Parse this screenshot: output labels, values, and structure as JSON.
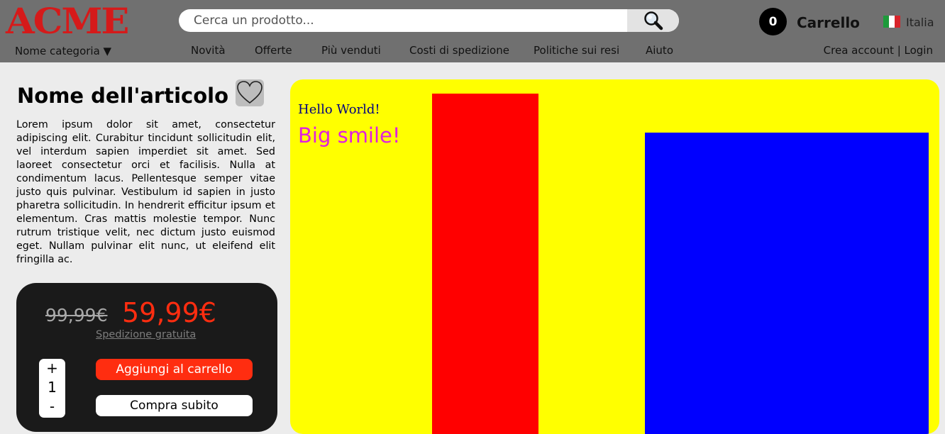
{
  "header": {
    "logo": "ACME",
    "category": "Nome categoria ▼",
    "search_placeholder": "Cerca un prodotto...",
    "cart_count": "0",
    "cart_label": "Carrello",
    "country": "Italia",
    "nav": [
      "Novità",
      "Offerte",
      "Più venduti",
      "Costi di spedizione",
      "Politiche sui resi",
      "Aiuto"
    ],
    "account": "Crea account | Login"
  },
  "product": {
    "title": "Nome dell'articolo",
    "description": "Lorem ipsum dolor sit amet, consectetur adipiscing elit. Curabitur tincidunt sollicitudin elit, vel interdum sapien imperdiet sit amet. Sed laoreet consectetur orci et facilisis. Nulla at condimentum lacus. Pellentesque semper vitae justo quis pulvinar. Vestibulum id sapien in justo pharetra sollicitudin. In hendrerit efficitur ipsum et elementum. Cras mattis molestie tempor. Nunc rutrum tristique velit, nec dictum justo euismod eget. Nullam pulvinar elit nunc, ut eleifend elit fringilla ac.",
    "old_price": "99,99€",
    "new_price": "59,99€",
    "shipping": "Spedizione gratuita",
    "qty_plus": "+",
    "qty_value": "1",
    "qty_minus": "-",
    "add_to_cart": "Aggiungi al carrello",
    "buy_now": "Compra subito"
  },
  "canvas": {
    "hello": "Hello World!",
    "smile": "Big smile!"
  },
  "colors": {
    "header_bg": "#707070",
    "logo": "#d51a1a",
    "accent": "#ff2d10",
    "canvas_bg": "#ffff00",
    "rect_red": "#ff0000",
    "rect_blue": "#0000ff"
  }
}
